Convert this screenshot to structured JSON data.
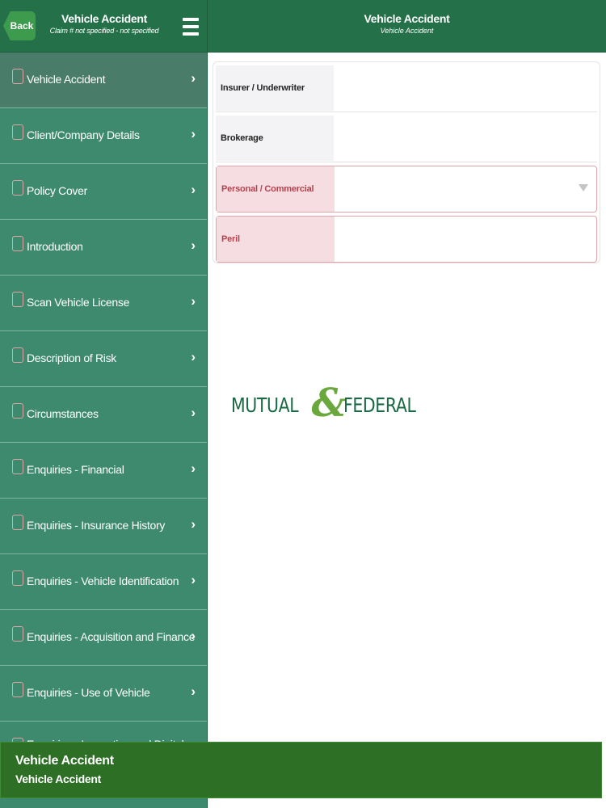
{
  "sidebar": {
    "back_label": "Back",
    "title": "Vehicle Accident",
    "subtitle": "Claim # not specified - not specified",
    "items": [
      {
        "label": "Vehicle Accident"
      },
      {
        "label": "Client/Company Details"
      },
      {
        "label": "Policy Cover"
      },
      {
        "label": "Introduction"
      },
      {
        "label": "Scan Vehicle License"
      },
      {
        "label": "Description of Risk"
      },
      {
        "label": "Circumstances"
      },
      {
        "label": "Enquiries - Financial"
      },
      {
        "label": "Enquiries - Insurance History"
      },
      {
        "label": "Enquiries - Vehicle Identification"
      },
      {
        "label": "Enquiries - Acquisition and Finance"
      },
      {
        "label": "Enquiries - Use of Vehicle"
      },
      {
        "label": "Enquiries - Inspection and Digital"
      }
    ]
  },
  "main": {
    "title": "Vehicle Accident",
    "subtitle": "Vehicle Accident",
    "form": {
      "rows": [
        {
          "label": "Insurer / Underwriter",
          "value": ""
        },
        {
          "label": "Brokerage",
          "value": ""
        },
        {
          "label": "Personal / Commercial",
          "value": ""
        },
        {
          "label": "Peril",
          "value": ""
        }
      ]
    },
    "logo": {
      "word1": "MUTUAL",
      "amp": "&",
      "word2": "FEDERAL"
    }
  },
  "banner": {
    "title": "Vehicle Accident",
    "subtitle": "Vehicle Accident"
  },
  "colors": {
    "header_green": "#237049",
    "sidebar_green": "#3d8a6f",
    "banner_green": "#2e6f26",
    "error_label_bg": "#f6dde1",
    "error_text": "#b2434f"
  }
}
